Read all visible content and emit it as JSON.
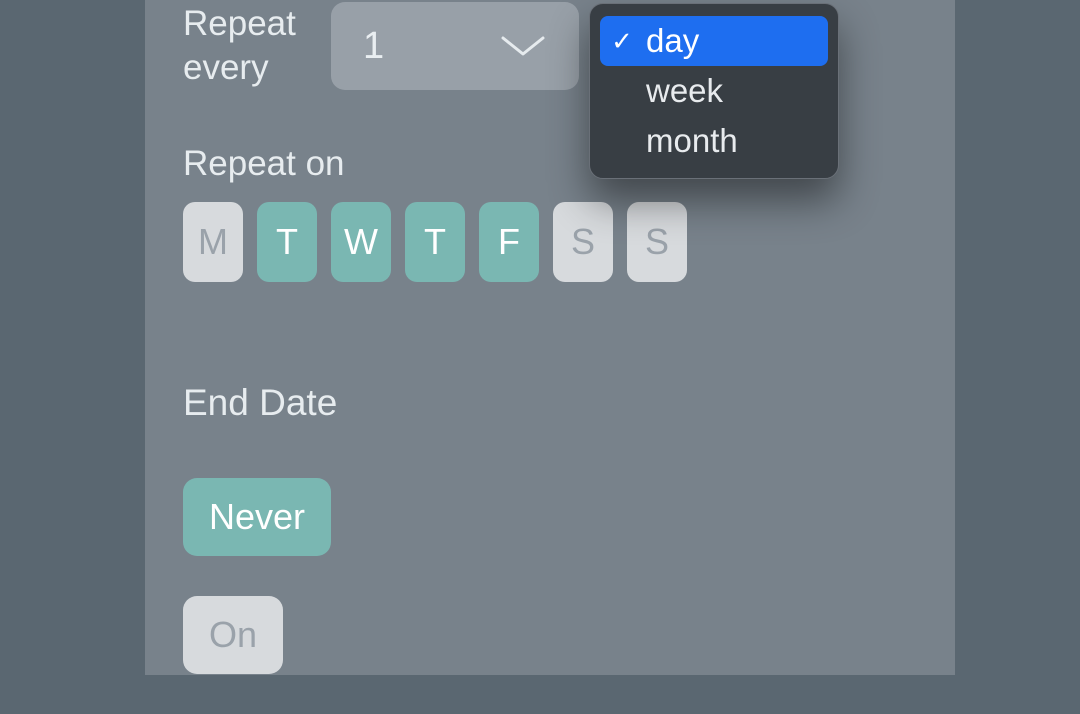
{
  "repeat": {
    "label": "Repeat every",
    "interval_value": "1",
    "unit_menu": {
      "options": [
        {
          "label": "day",
          "selected": true
        },
        {
          "label": "week",
          "selected": false
        },
        {
          "label": "month",
          "selected": false
        }
      ],
      "checkmark": "✓"
    }
  },
  "repeat_on": {
    "label": "Repeat on",
    "days": [
      {
        "letter": "M",
        "selected": false
      },
      {
        "letter": "T",
        "selected": true
      },
      {
        "letter": "W",
        "selected": true
      },
      {
        "letter": "T",
        "selected": true
      },
      {
        "letter": "F",
        "selected": true
      },
      {
        "letter": "S",
        "selected": false
      },
      {
        "letter": "S",
        "selected": false
      }
    ]
  },
  "end_date": {
    "label": "End Date",
    "never_label": "Never",
    "on_label": "On",
    "never_selected": true,
    "on_selected": false
  }
}
